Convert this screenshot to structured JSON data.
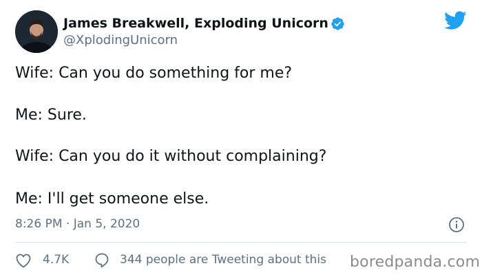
{
  "author": {
    "display_name": "James Breakwell, Exploding Unicorn",
    "handle": "@XplodingUnicorn",
    "verified": true
  },
  "tweet": {
    "lines": [
      "Wife: Can you do something for me?",
      "Me: Sure.",
      "Wife: Can you do it without complaining?",
      "Me: I'll get someone else."
    ],
    "timestamp": "8:26 PM · Jan 5, 2020"
  },
  "actions": {
    "likes": "4.7K",
    "replies": "344 people are Tweeting about this"
  },
  "watermark": "boredpanda.com",
  "icons": {
    "brand": "twitter-bird-icon",
    "verified": "verified-badge-icon",
    "info": "info-icon",
    "like": "heart-icon",
    "reply": "reply-bubble-icon"
  },
  "colors": {
    "brand_blue": "#1da1f2",
    "text_primary": "#0f1419",
    "text_secondary": "#5b7083",
    "divider": "#dbe1e6"
  }
}
